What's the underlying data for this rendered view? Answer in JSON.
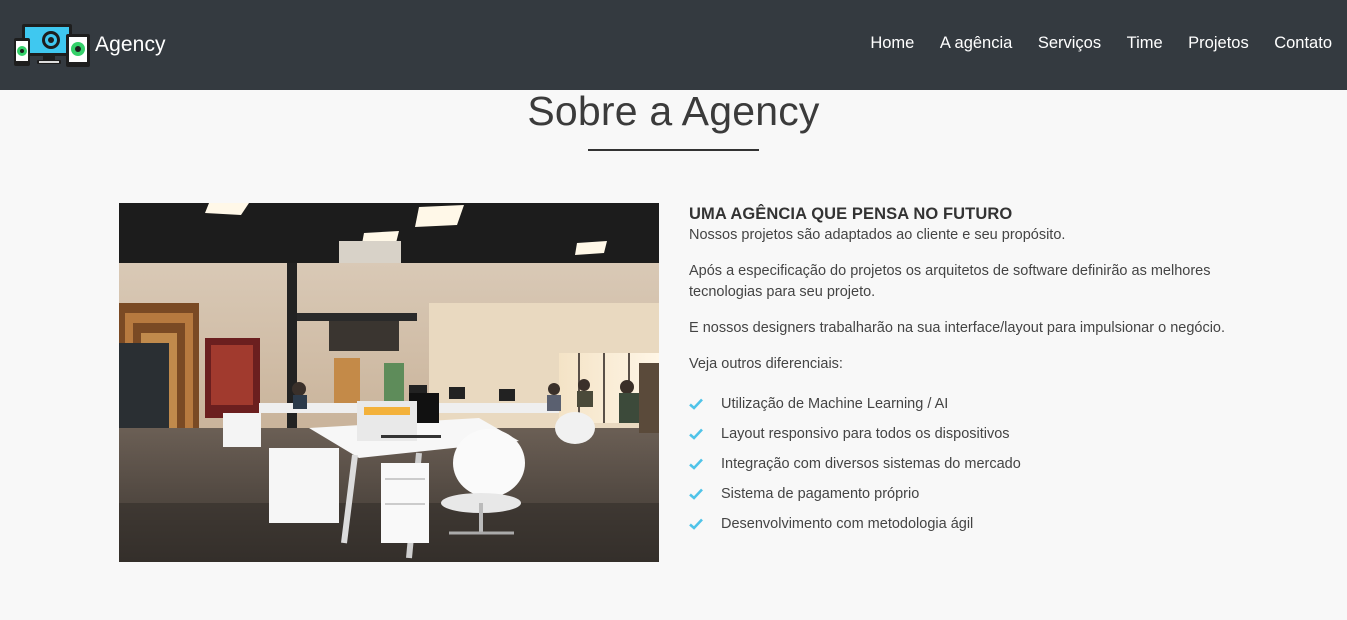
{
  "navbar": {
    "brand": "Agency",
    "links": [
      "Home",
      "A agência",
      "Serviços",
      "Time",
      "Projetos",
      "Contato"
    ]
  },
  "about": {
    "title": "Sobre a Agency",
    "subheading": "UMA AGÊNCIA QUE PENSA NO FUTURO",
    "paragraphs": [
      "Nossos projetos são adaptados ao cliente e seu propósito.",
      "Após a especificação do projetos os arquitetos de software definirão as melhores tecnologias para seu projeto.",
      "E nossos designers trabalharão na sua interface/layout para impulsionar o negócio.",
      "Veja outros diferenciais:"
    ],
    "features": [
      "Utilização de Machine Learning / AI",
      "Layout responsivo para todos os dispositivos",
      "Integração com diversos sistemas do mercado",
      "Sistema de pagamento próprio",
      "Desenvolvimento com metodologia ágil"
    ]
  },
  "icons": {
    "logo": "devices-logo-icon",
    "feature_bullet": "check-icon"
  },
  "colors": {
    "navbar_bg": "#343a40",
    "page_bg": "#f8f8f8",
    "check": "#4fc3e8",
    "logo_screen": "#3fc8f0",
    "logo_accent": "#35d06a"
  }
}
